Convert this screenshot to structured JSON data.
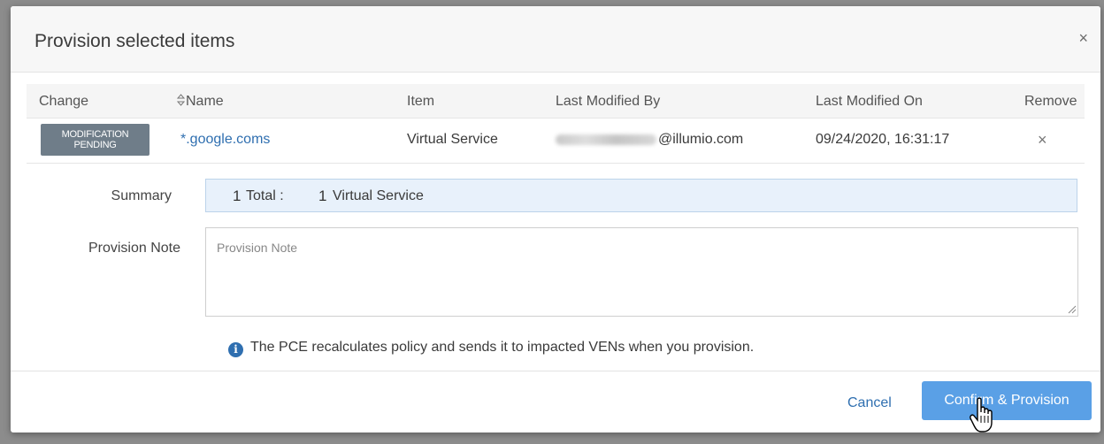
{
  "dialog": {
    "title": "Provision selected items",
    "close_icon": "close-icon"
  },
  "table": {
    "headers": {
      "change": "Change",
      "name": "Name",
      "item": "Item",
      "last_modified_by": "Last Modified By",
      "last_modified_on": "Last Modified On",
      "remove": "Remove"
    },
    "rows": [
      {
        "change_badge_line1": "MODIFICATION",
        "change_badge_line2": "PENDING",
        "name": "*.google.coms",
        "item": "Virtual Service",
        "modified_by_domain": "@illumio.com",
        "modified_on": "09/24/2020, 16:31:17",
        "remove": "×"
      }
    ]
  },
  "summary": {
    "label": "Summary",
    "total_count": "1",
    "total_label": "Total :",
    "vs_count": "1",
    "vs_label": "Virtual Service"
  },
  "provision_note": {
    "label": "Provision Note",
    "placeholder": "Provision Note",
    "value": ""
  },
  "info": {
    "icon": "info-icon",
    "text": "The PCE recalculates policy and sends it to impacted VENs when you provision."
  },
  "footer": {
    "cancel_label": "Cancel",
    "confirm_label": "Confirm & Provision"
  },
  "colors": {
    "accent": "#5aa0e6",
    "link": "#2f6fb0",
    "badge": "#6f7d89",
    "summary_bg": "#e8f1fb"
  }
}
